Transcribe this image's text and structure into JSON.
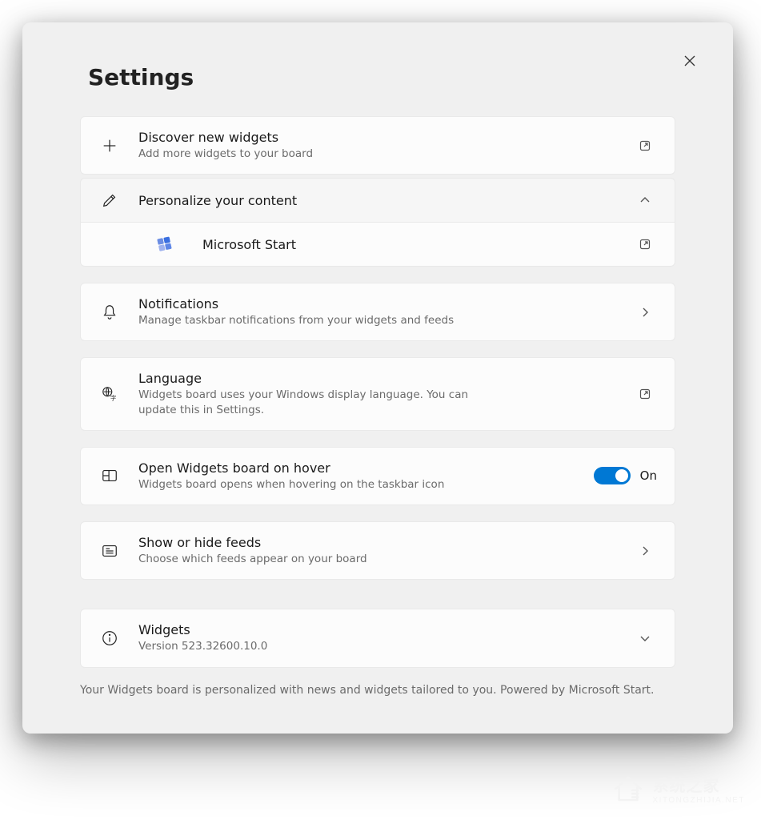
{
  "header": {
    "title": "Settings"
  },
  "discover": {
    "title": "Discover new widgets",
    "subtitle": "Add more widgets to your board"
  },
  "personalize": {
    "title": "Personalize your content",
    "sub_item_label": "Microsoft Start"
  },
  "notifications": {
    "title": "Notifications",
    "subtitle": "Manage taskbar notifications from your widgets and feeds"
  },
  "language": {
    "title": "Language",
    "subtitle": "Widgets board uses your Windows display language. You can update this in Settings."
  },
  "hover": {
    "title": "Open Widgets board on hover",
    "subtitle": "Widgets board opens when hovering on the taskbar icon",
    "toggle_label": "On",
    "toggle_on": true
  },
  "feeds": {
    "title": "Show or hide feeds",
    "subtitle": "Choose which feeds appear on your board"
  },
  "about": {
    "title": "Widgets",
    "subtitle": "Version 523.32600.10.0"
  },
  "footer_note": "Your Widgets board is personalized with news and widgets tailored to you. Powered by Microsoft Start.",
  "watermark": {
    "main": "系统之家",
    "sub": "XITONGZHIJIA.NET"
  },
  "colors": {
    "panel_bg": "#f0f0f0",
    "card_bg": "#fcfcfc",
    "accent": "#0078d4",
    "text_muted": "#6b6b6b"
  }
}
